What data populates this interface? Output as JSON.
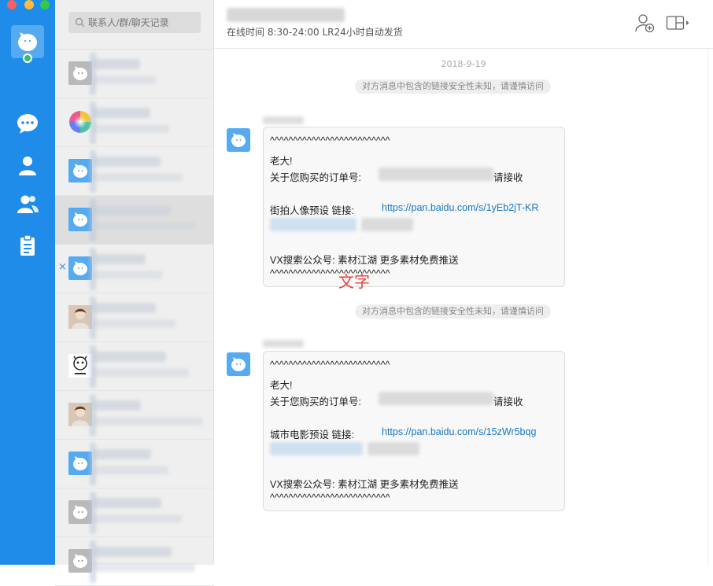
{
  "window": {
    "controls": [
      "close",
      "minimize",
      "zoom"
    ]
  },
  "rail": {
    "icons": [
      "chat-bubble-icon",
      "user-icon",
      "group-icon",
      "clipboard-icon"
    ],
    "accent": "#1e8ce8"
  },
  "search": {
    "placeholder": "联系人/群/聊天记录"
  },
  "contacts": [
    {
      "avatar": "bot",
      "active": false
    },
    {
      "avatar": "color-wheel",
      "active": false
    },
    {
      "avatar": "bot",
      "active": false
    },
    {
      "avatar": "bot",
      "active": true
    },
    {
      "avatar": "bot",
      "active": false,
      "close": "×"
    },
    {
      "avatar": "photo",
      "active": false
    },
    {
      "avatar": "cartoon",
      "active": false
    },
    {
      "avatar": "photo",
      "active": false
    },
    {
      "avatar": "bot",
      "active": false
    },
    {
      "avatar": "bot",
      "active": false
    },
    {
      "avatar": "bot",
      "active": false
    }
  ],
  "header": {
    "status": "在线时间  8:30-24:00  LR24小时自动发货",
    "icons": [
      "add-contact-icon",
      "panel-toggle-icon"
    ]
  },
  "conversation": {
    "date": "2018-9-19",
    "notice": "对方消息中包含的链接安全性未知，请谨慎访问",
    "messages": [
      {
        "divider_top": "^^^^^^^^^^^^^^^^^^^^^^^^^^",
        "greeting": "老大!",
        "order_prefix": "关于您购买的订单号:",
        "order_suffix": "请接收",
        "preset_label": "街拍人像预设 链接:",
        "link": "https://pan.baidu.com/s/1yEb2jT-KR",
        "promo": "VX搜索公众号: 素材江湖    更多素材免费推送",
        "divider_bottom": "^^^^^^^^^^^^^^^^^^^^^^^^^^"
      },
      {
        "divider_top": "^^^^^^^^^^^^^^^^^^^^^^^^^^",
        "greeting": "老大!",
        "order_prefix": "关于您购买的订单号:",
        "order_suffix": "请接收",
        "preset_label": "城市电影预设 链接:",
        "link": "https://pan.baidu.com/s/15zWr5bqg",
        "promo": "VX搜索公众号: 素材江湖    更多素材免费推送",
        "divider_bottom": "^^^^^^^^^^^^^^^^^^^^^^^^^^"
      }
    ],
    "overlay_label": "文字",
    "overlay_color": "#e8413b"
  }
}
